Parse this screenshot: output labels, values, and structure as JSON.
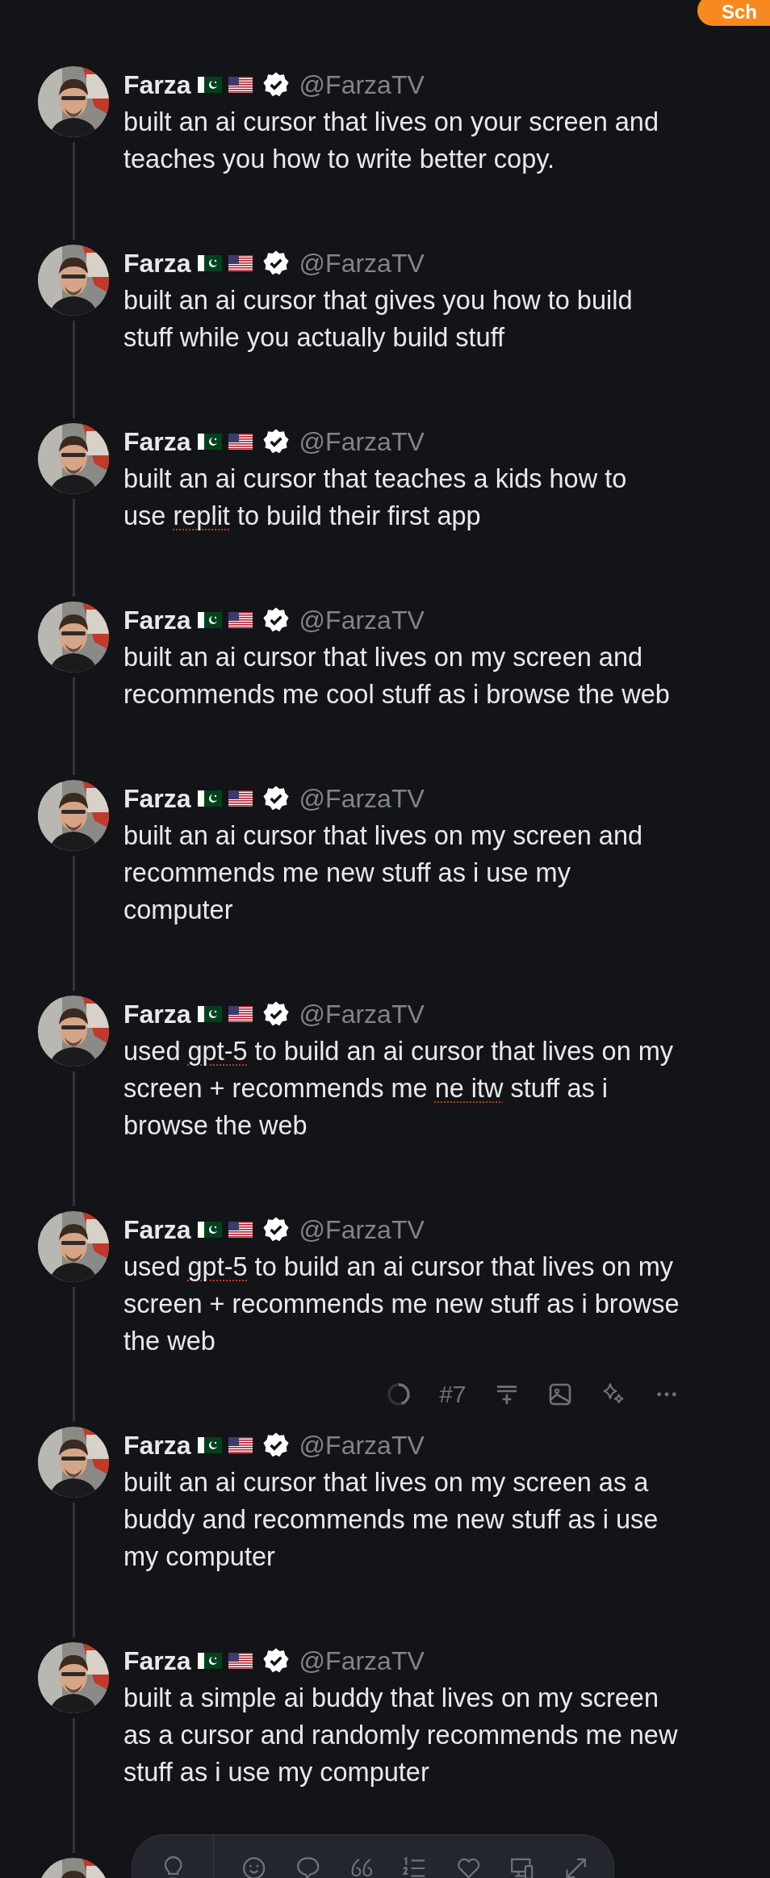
{
  "top_button": {
    "label": "Sch"
  },
  "tweets": [
    {
      "name": "Farza",
      "handle": "@FarzaTV",
      "verified": true,
      "lines": [
        [
          {
            "text": "built an ai cursor that lives on your screen and",
            "misspelled": false
          }
        ],
        [
          {
            "text": "teaches you how to write better copy.",
            "misspelled": false
          }
        ]
      ]
    },
    {
      "name": "Farza",
      "handle": "@FarzaTV",
      "verified": true,
      "lines": [
        [
          {
            "text": "built an ai cursor that gives you how to build",
            "misspelled": false
          }
        ],
        [
          {
            "text": "stuff while you actually build stuff",
            "misspelled": false
          }
        ]
      ]
    },
    {
      "name": "Farza",
      "handle": "@FarzaTV",
      "verified": true,
      "lines": [
        [
          {
            "text": "built an ai cursor that teaches a kids how to",
            "misspelled": false
          }
        ],
        [
          {
            "text": "use ",
            "misspelled": false
          },
          {
            "text": "replit",
            "misspelled": true
          },
          {
            "text": " to build their first app",
            "misspelled": false
          }
        ]
      ]
    },
    {
      "name": "Farza",
      "handle": "@FarzaTV",
      "verified": true,
      "lines": [
        [
          {
            "text": "built an ai cursor that lives on my screen and",
            "misspelled": false
          }
        ],
        [
          {
            "text": "recommends me cool stuff as i browse the web",
            "misspelled": false
          }
        ]
      ]
    },
    {
      "name": "Farza",
      "handle": "@FarzaTV",
      "verified": true,
      "lines": [
        [
          {
            "text": "built an ai cursor that lives on my screen and",
            "misspelled": false
          }
        ],
        [
          {
            "text": "recommends me new stuff as i use my",
            "misspelled": false
          }
        ],
        [
          {
            "text": "computer",
            "misspelled": false
          }
        ]
      ]
    },
    {
      "name": "Farza",
      "handle": "@FarzaTV",
      "verified": true,
      "lines": [
        [
          {
            "text": "used ",
            "misspelled": false
          },
          {
            "text": "gpt-5",
            "misspelled": true
          },
          {
            "text": " to build an ai cursor that lives on my",
            "misspelled": false
          }
        ],
        [
          {
            "text": "screen + recommends me ",
            "misspelled": false
          },
          {
            "text": "ne",
            "misspelled": true
          },
          {
            "text": " itw",
            "misspelled": true
          },
          {
            "text": " stuff as i",
            "misspelled": false
          }
        ],
        [
          {
            "text": "browse the web",
            "misspelled": false
          }
        ]
      ]
    },
    {
      "name": "Farza",
      "handle": "@FarzaTV",
      "verified": true,
      "lines": [
        [
          {
            "text": "used ",
            "misspelled": false
          },
          {
            "text": "gpt-5",
            "misspelled": true
          },
          {
            "text": " to build an ai cursor that lives on my",
            "misspelled": false
          }
        ],
        [
          {
            "text": "screen + recommends me new stuff as i browse",
            "misspelled": false
          }
        ],
        [
          {
            "text": "the web",
            "misspelled": false
          }
        ]
      ],
      "toolbar": {
        "counter": "#7"
      }
    },
    {
      "name": "Farza",
      "handle": "@FarzaTV",
      "verified": true,
      "lines": [
        [
          {
            "text": "built an ai cursor that lives on my screen as a",
            "misspelled": false
          }
        ],
        [
          {
            "text": "buddy and recommends me new stuff as i use",
            "misspelled": false
          }
        ],
        [
          {
            "text": "my computer",
            "misspelled": false
          }
        ]
      ]
    },
    {
      "name": "Farza",
      "handle": "@FarzaTV",
      "verified": true,
      "lines": [
        [
          {
            "text": "built a simple ai buddy that lives on my screen",
            "misspelled": false
          }
        ],
        [
          {
            "text": "as a cursor and randomly recommends me new",
            "misspelled": false
          }
        ],
        [
          {
            "text": "stuff as i use my computer",
            "misspelled": false
          }
        ]
      ]
    },
    {
      "kind": "partial"
    }
  ],
  "bottom_toolbar": [
    {
      "kind": "bulb"
    },
    {
      "kind": "divider"
    },
    {
      "kind": "smile"
    },
    {
      "kind": "bubble"
    },
    {
      "kind": "quote"
    },
    {
      "kind": "list"
    },
    {
      "kind": "heart"
    },
    {
      "kind": "devices"
    },
    {
      "kind": "expand"
    }
  ]
}
